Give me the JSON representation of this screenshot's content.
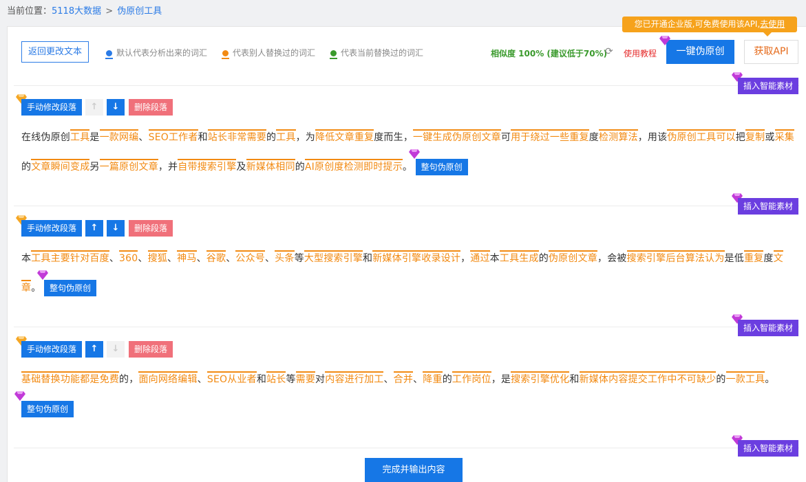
{
  "breadcrumb": {
    "prefix": "当前位置：",
    "home": "5118大数据",
    "sep": ">",
    "current": "伪原创工具"
  },
  "toolbar": {
    "return_label": "返回更改文本",
    "legend_blue": "默认代表分析出来的词汇",
    "legend_orange": "代表别人替换过的词汇",
    "legend_green": "代表当前替换过的词汇",
    "similarity": "相似度 100% (建议低于70%)",
    "tutorial": "使用教程",
    "oneclick_label": "一键伪原创",
    "api_label": "获取API",
    "tip_text": "您已开通企业版,可免费使用该API,",
    "tip_link": "去使用"
  },
  "labels": {
    "insert": "插入智能素材",
    "manual": "手动修改段落",
    "delete": "删除段落",
    "whole": "整句伪原创",
    "up": "↑",
    "down": "↓",
    "finish": "完成并输出内容"
  },
  "paragraphs": [
    {
      "segments": [
        {
          "t": "在线伪原创"
        },
        {
          "t": "工具",
          "w": 1
        },
        {
          "t": "是"
        },
        {
          "t": "一款",
          "w": 1
        },
        {
          "t": "网编",
          "w": 1
        },
        {
          "t": "、"
        },
        {
          "t": "SEO工作者",
          "w": 1
        },
        {
          "t": "和"
        },
        {
          "t": "站长",
          "w": 1
        },
        {
          "t": "非常",
          "w": 1
        },
        {
          "t": "需要",
          "w": 1
        },
        {
          "t": "的"
        },
        {
          "t": "工具",
          "w": 1
        },
        {
          "t": "，为"
        },
        {
          "t": "降低",
          "w": 1
        },
        {
          "t": "文章",
          "w": 1
        },
        {
          "t": "重复",
          "w": 1
        },
        {
          "t": "度而生，"
        },
        {
          "t": "一键",
          "w": 1
        },
        {
          "t": "生成",
          "w": 1
        },
        {
          "t": "伪原创",
          "w": 1
        },
        {
          "t": "文章",
          "w": 1
        },
        {
          "t": "可"
        },
        {
          "t": "用于",
          "w": 1
        },
        {
          "t": "绕过",
          "w": 1
        },
        {
          "t": "一些",
          "w": 1
        },
        {
          "t": "重复",
          "w": 1
        },
        {
          "t": "度"
        },
        {
          "t": "检测",
          "w": 1
        },
        {
          "t": "算法",
          "w": 1
        },
        {
          "t": "，用该"
        },
        {
          "t": "伪原创",
          "w": 1
        },
        {
          "t": "工具",
          "w": 1
        },
        {
          "t": "可以",
          "w": 1
        },
        {
          "t": "把"
        },
        {
          "t": "复制",
          "w": 1
        },
        {
          "t": "或"
        },
        {
          "t": "采集",
          "w": 1
        },
        {
          "t": "的"
        },
        {
          "t": "文章",
          "w": 1
        },
        {
          "t": "瞬间",
          "w": 1
        },
        {
          "t": "变成",
          "w": 1
        },
        {
          "t": "另"
        },
        {
          "t": "一篇",
          "w": 1
        },
        {
          "t": "原创",
          "w": 1
        },
        {
          "t": "文章",
          "w": 1
        },
        {
          "t": "，并"
        },
        {
          "t": "自带",
          "w": 1
        },
        {
          "t": "搜索引擎",
          "w": 1
        },
        {
          "t": "及"
        },
        {
          "t": "新媒体",
          "w": 1
        },
        {
          "t": "相同",
          "w": 1
        },
        {
          "t": "的"
        },
        {
          "t": "AI",
          "w": 1
        },
        {
          "t": "原创度",
          "w": 1
        },
        {
          "t": "检测",
          "w": 1
        },
        {
          "t": "即时",
          "w": 1
        },
        {
          "t": "提示",
          "w": 1
        },
        {
          "t": "。"
        }
      ]
    },
    {
      "segments": [
        {
          "t": "本"
        },
        {
          "t": "工具",
          "w": 1
        },
        {
          "t": "主要",
          "w": 1
        },
        {
          "t": "针对",
          "w": 1
        },
        {
          "t": "百度",
          "w": 1
        },
        {
          "t": "、"
        },
        {
          "t": "360",
          "w": 1
        },
        {
          "t": "、"
        },
        {
          "t": "搜狐",
          "w": 1
        },
        {
          "t": "、"
        },
        {
          "t": "神马",
          "w": 1
        },
        {
          "t": "、"
        },
        {
          "t": "谷歌",
          "w": 1
        },
        {
          "t": "、"
        },
        {
          "t": "公众号",
          "w": 1
        },
        {
          "t": "、"
        },
        {
          "t": "头条",
          "w": 1
        },
        {
          "t": "等"
        },
        {
          "t": "大型",
          "w": 1
        },
        {
          "t": "搜索引擎",
          "w": 1
        },
        {
          "t": "和"
        },
        {
          "t": "新媒体",
          "w": 1
        },
        {
          "t": "引擎",
          "w": 1
        },
        {
          "t": "收录",
          "w": 1
        },
        {
          "t": "设计",
          "w": 1
        },
        {
          "t": "，"
        },
        {
          "t": "通过",
          "w": 1
        },
        {
          "t": "本"
        },
        {
          "t": "工具",
          "w": 1
        },
        {
          "t": "生成",
          "w": 1
        },
        {
          "t": "的"
        },
        {
          "t": "伪原创",
          "w": 1
        },
        {
          "t": "文章",
          "w": 1
        },
        {
          "t": "，会被"
        },
        {
          "t": "搜索引擎",
          "w": 1
        },
        {
          "t": "后台",
          "w": 1
        },
        {
          "t": "算法",
          "w": 1
        },
        {
          "t": "认为",
          "w": 1
        },
        {
          "t": "是低"
        },
        {
          "t": "重复",
          "w": 1
        },
        {
          "t": "度"
        },
        {
          "t": "文章",
          "w": 1
        },
        {
          "t": "。"
        }
      ]
    },
    {
      "segments": [
        {
          "t": "基础",
          "w": 1
        },
        {
          "t": "替换",
          "w": 1
        },
        {
          "t": "功能",
          "w": 1
        },
        {
          "t": "都是",
          "w": 1
        },
        {
          "t": "免费",
          "w": 1
        },
        {
          "t": "的，"
        },
        {
          "t": "面向",
          "w": 1
        },
        {
          "t": "网络",
          "w": 1
        },
        {
          "t": "编辑",
          "w": 1
        },
        {
          "t": "、"
        },
        {
          "t": "SEO",
          "w": 1
        },
        {
          "t": "从业者",
          "w": 1
        },
        {
          "t": "和"
        },
        {
          "t": "站长",
          "w": 1
        },
        {
          "t": "等"
        },
        {
          "t": "需要",
          "w": 1
        },
        {
          "t": "对"
        },
        {
          "t": "内容",
          "w": 1
        },
        {
          "t": "进行",
          "w": 1
        },
        {
          "t": "加工",
          "w": 1
        },
        {
          "t": "、"
        },
        {
          "t": "合并",
          "w": 1
        },
        {
          "t": "、"
        },
        {
          "t": "降重",
          "w": 1
        },
        {
          "t": "的"
        },
        {
          "t": "工作",
          "w": 1
        },
        {
          "t": "岗位",
          "w": 1
        },
        {
          "t": "，是"
        },
        {
          "t": "搜索引擎",
          "w": 1
        },
        {
          "t": "优化",
          "w": 1
        },
        {
          "t": "和"
        },
        {
          "t": "新媒体",
          "w": 1
        },
        {
          "t": "内容",
          "w": 1
        },
        {
          "t": "提交",
          "w": 1
        },
        {
          "t": "工作",
          "w": 1
        },
        {
          "t": "中",
          "w": 1
        },
        {
          "t": "不可",
          "w": 1
        },
        {
          "t": "缺少",
          "w": 1
        },
        {
          "t": "的"
        },
        {
          "t": "一款",
          "w": 1
        },
        {
          "t": "工具",
          "w": 1
        },
        {
          "t": "。"
        }
      ]
    }
  ]
}
